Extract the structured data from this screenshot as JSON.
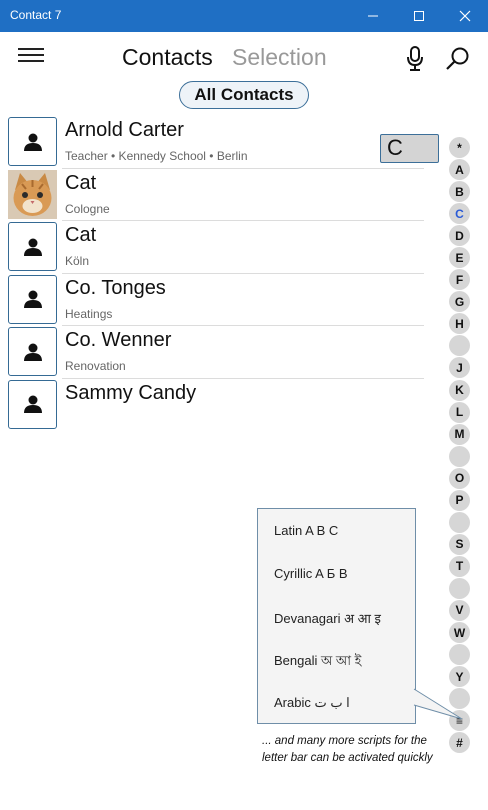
{
  "window": {
    "title": "Contact 7"
  },
  "tabs": {
    "contacts": "Contacts",
    "selection": "Selection"
  },
  "filter": {
    "label": "All Contacts"
  },
  "contacts": [
    {
      "name": "Arnold Carter",
      "detail": "Teacher • Kennedy School • Berlin",
      "avatar": "person-icon"
    },
    {
      "name": "Cat",
      "detail": "Cologne",
      "avatar": "cat-photo"
    },
    {
      "name": "Cat",
      "detail": "Köln",
      "avatar": "person-icon"
    },
    {
      "name": "Co. Tonges",
      "detail": "Heatings",
      "avatar": "person-icon"
    },
    {
      "name": "Co. Wenner",
      "detail": "Renovation",
      "avatar": "person-icon"
    },
    {
      "name": "Sammy Candy",
      "detail": "",
      "avatar": "person-icon"
    }
  ],
  "current_letter": "C",
  "letter_bar": [
    "*",
    "A",
    "B",
    "C",
    "D",
    "E",
    "F",
    "G",
    "H",
    "",
    "J",
    "K",
    "L",
    "M",
    "",
    "O",
    "P",
    "",
    "S",
    "T",
    "",
    "V",
    "W",
    "",
    "Y",
    "",
    "≡",
    "#"
  ],
  "active_letter": "C",
  "scripts_popup": [
    "Latin  A B C",
    "Cyrillic  A Б В",
    "Devanagari  अ आ इ",
    "Bengali  অ আ ই",
    "Arabic  ا ب ت"
  ],
  "note": "... and many more scripts for the letter bar can be activated quickly",
  "colors": {
    "titlebar": "#1f6fc4",
    "accent": "#356a94"
  }
}
